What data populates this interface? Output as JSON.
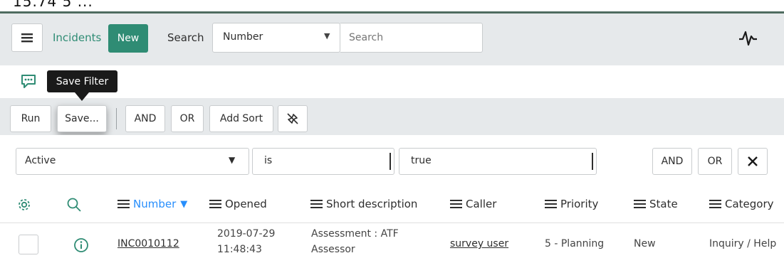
{
  "top_strip_text": "15.74 5 ...",
  "header": {
    "menu_icon": "hamburger-icon",
    "title": "Incidents",
    "new_label": "New",
    "search_label": "Search",
    "search_field": "Number",
    "search_placeholder": "Search",
    "activity_icon": "activity-stream-icon"
  },
  "tooltip": "Save Filter",
  "toolbar_icons": [
    "chat-bubble-icon"
  ],
  "filter_bar": {
    "run": "Run",
    "save": "Save...",
    "and": "AND",
    "or": "OR",
    "add_sort": "Add Sort",
    "remove_icon": "pin-remove-icon"
  },
  "condition": {
    "field": "Active",
    "operator": "is",
    "value": "true",
    "and": "AND",
    "or": "OR",
    "remove_icon": "close-icon"
  },
  "table": {
    "columns": [
      "Number",
      "Opened",
      "Short description",
      "Caller",
      "Priority",
      "State",
      "Category"
    ],
    "sort_indicator": "▼",
    "rows": [
      {
        "number": "INC0010112",
        "opened_date": "2019-07-29",
        "opened_time": "11:48:43",
        "short_description_line1": "Assessment : ATF",
        "short_description_line2": "Assessor",
        "caller": "survey user",
        "priority": "5 - Planning",
        "state": "New",
        "category": "Inquiry / Help"
      }
    ]
  },
  "colors": {
    "accent": "#278efc",
    "brand_green": "#2f8c74",
    "header_bg": "#e6e9eb",
    "tooltip_bg": "#1a1a1a"
  }
}
